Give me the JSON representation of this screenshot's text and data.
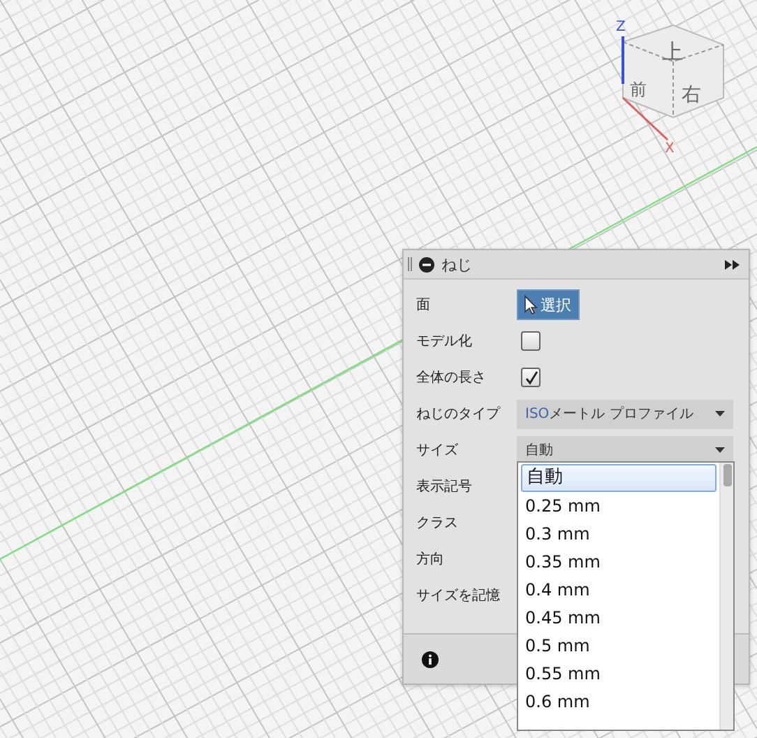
{
  "viewcube": {
    "faces": [
      "上",
      "前",
      "右"
    ],
    "axes": [
      "Z",
      "X"
    ]
  },
  "dialog": {
    "title": "ねじ",
    "rows": [
      {
        "label": "面",
        "kind": "button",
        "value": "選択"
      },
      {
        "label": "モデル化",
        "kind": "checkbox",
        "checked": false
      },
      {
        "label": "全体の長さ",
        "kind": "checkbox",
        "checked": true
      },
      {
        "label": "ねじのタイプ",
        "kind": "select",
        "prefix": "ISO",
        "value": "メートル プロファイル"
      },
      {
        "label": "サイズ",
        "kind": "select",
        "value": "自動"
      },
      {
        "label": "表示記号",
        "kind": "label"
      },
      {
        "label": "クラス",
        "kind": "label"
      },
      {
        "label": "方向",
        "kind": "label"
      },
      {
        "label": "サイズを記憶",
        "kind": "label"
      }
    ]
  },
  "dropdown": {
    "options": [
      {
        "label": "自動",
        "selected": true
      },
      {
        "label": "0.25 mm",
        "selected": false
      },
      {
        "label": "0.3 mm",
        "selected": false
      },
      {
        "label": "0.35 mm",
        "selected": false
      },
      {
        "label": "0.4 mm",
        "selected": false
      },
      {
        "label": "0.45 mm",
        "selected": false
      },
      {
        "label": "0.5 mm",
        "selected": false
      },
      {
        "label": "0.55 mm",
        "selected": false
      },
      {
        "label": "0.6 mm",
        "selected": false
      }
    ]
  }
}
